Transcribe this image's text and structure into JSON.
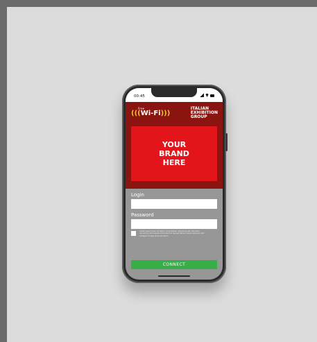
{
  "status_bar": {
    "time": "00:45",
    "icons": [
      "signal-icon",
      "wifi-icon",
      "battery-icon"
    ]
  },
  "header": {
    "wifi_logo_small": "Free",
    "wifi_logo_main": "Wi-Fi",
    "organization": [
      "ITALIAN",
      "EXHIBITION",
      "GROUP"
    ],
    "brand_placeholder": "YOUR BRAND HERE"
  },
  "form": {
    "login_label": "Login",
    "login_value": "",
    "password_label": "Password",
    "password_value": "",
    "consent_text": "Lorem ipsum dolor sit amet, consectetuer adipiscing elit, sed diam nonummy nibh euismod tincidunt ut laoreet dolore magna aliquam erat volutpat. Ut wisi enim ad minim.",
    "connect_label": "CONNECT"
  },
  "colors": {
    "header_red": "#8a1410",
    "brand_red": "#e3141a",
    "connect_green": "#38ae48",
    "wifi_yellow": "#f2c230"
  }
}
